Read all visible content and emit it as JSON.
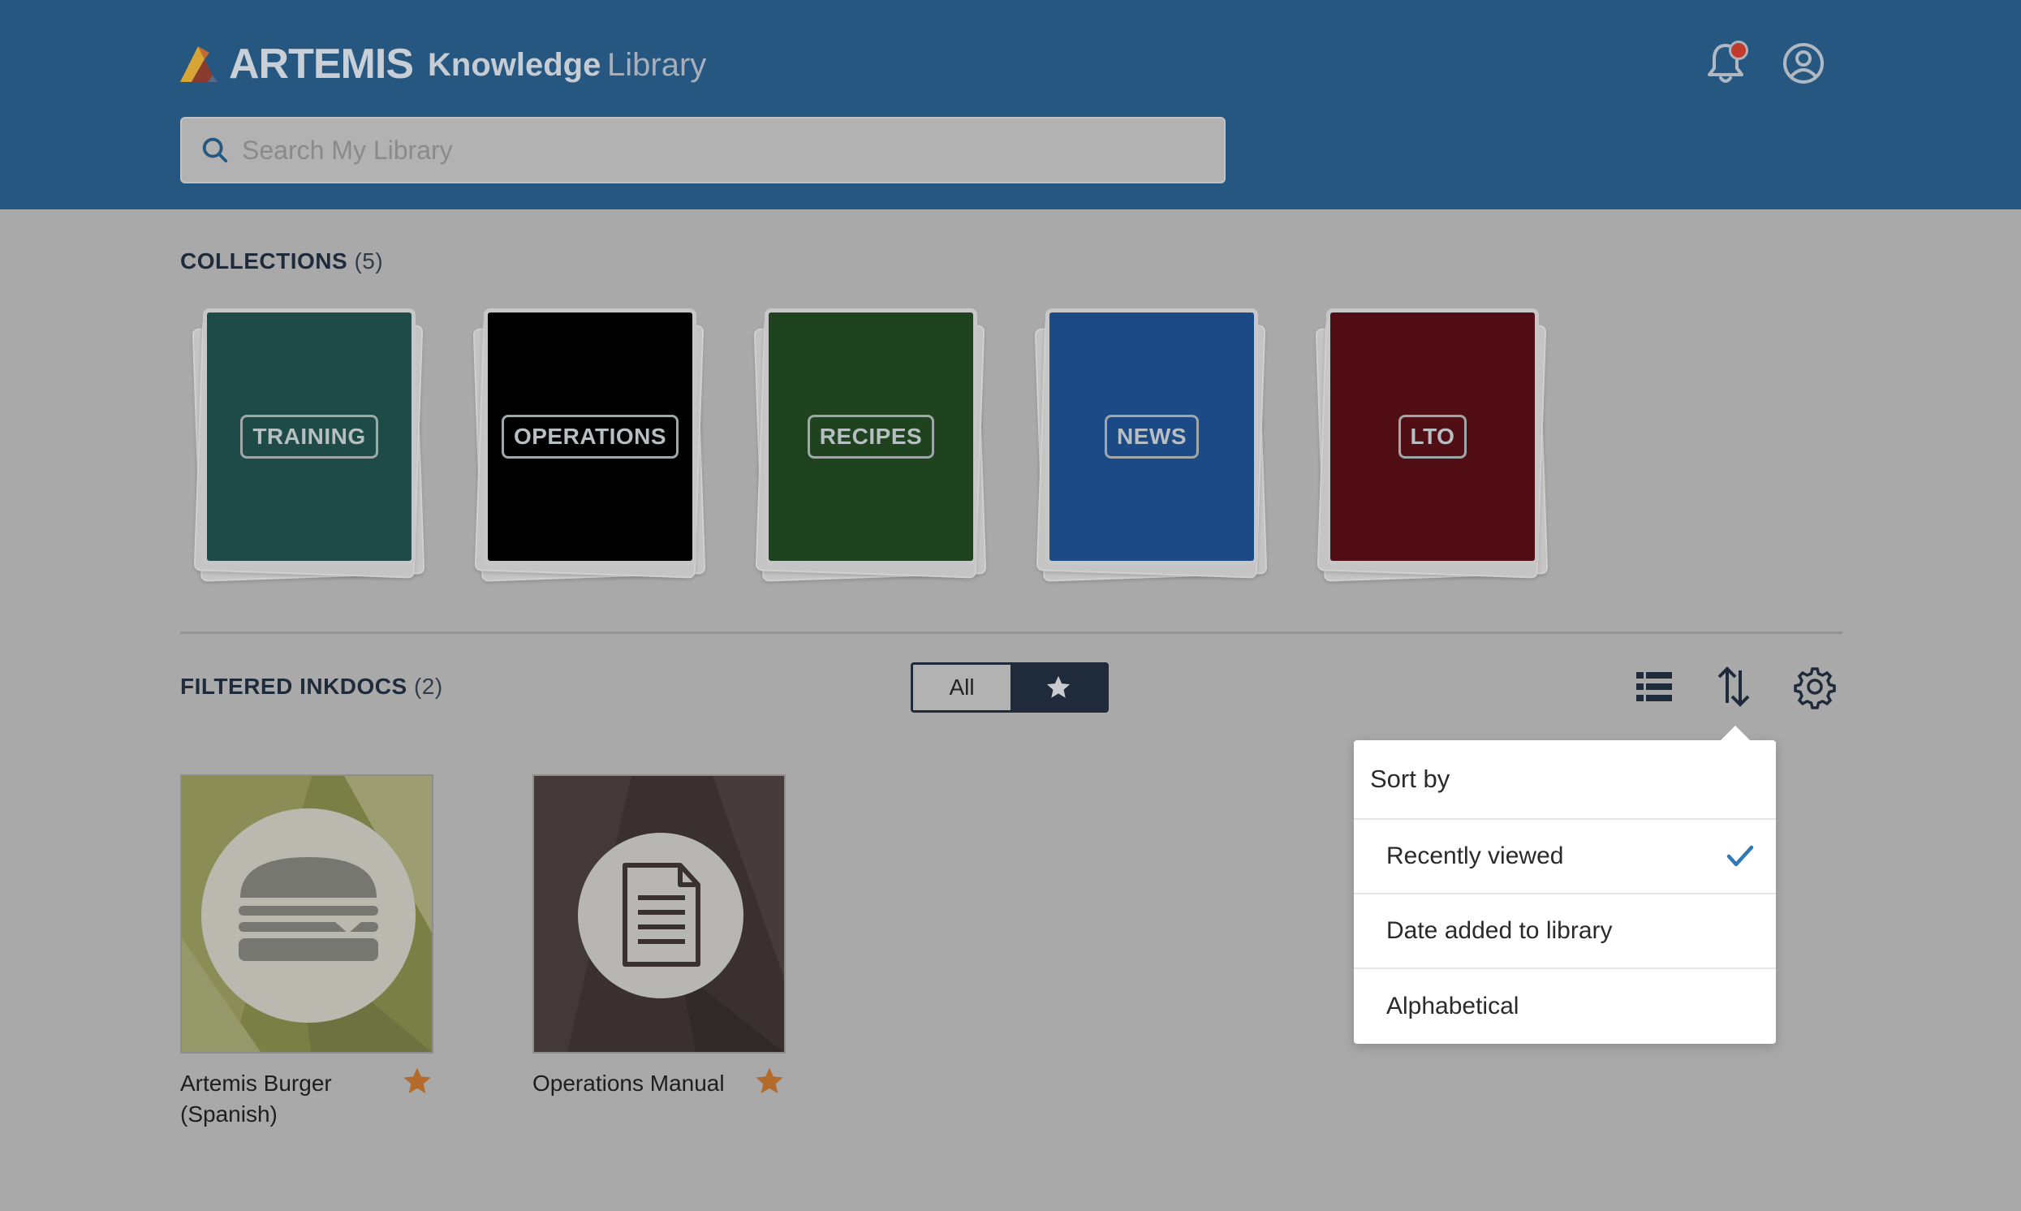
{
  "header": {
    "brand": "ARTEMIS",
    "product_main": "Knowledge",
    "product_sub": "Library",
    "search_placeholder": "Search My Library",
    "icons": [
      "bell-icon",
      "user-icon",
      "search-icon"
    ]
  },
  "collections": {
    "title": "COLLECTIONS",
    "count": "(5)",
    "items": [
      {
        "label": "TRAINING",
        "color": "#1e4a47"
      },
      {
        "label": "OPERATIONS",
        "color": "#000000"
      },
      {
        "label": "RECIPES",
        "color": "#1f431f"
      },
      {
        "label": "NEWS",
        "color": "#1b4a86"
      },
      {
        "label": "LTO",
        "color": "#510f15"
      }
    ]
  },
  "inkdocs": {
    "title": "FILTERED INKDOCS",
    "count": "(2)",
    "filter_all": "All",
    "items": [
      {
        "title": "Artemis Burger (Spanish)",
        "starred": true,
        "icon": "burger-icon"
      },
      {
        "title": "Operations Manual",
        "starred": true,
        "icon": "document-icon"
      }
    ]
  },
  "toolbar": {
    "icons": [
      "list-view-icon",
      "sort-icon",
      "settings-icon"
    ]
  },
  "sort_menu": {
    "heading": "Sort by",
    "options": [
      {
        "label": "Recently viewed",
        "selected": true
      },
      {
        "label": "Date added to library",
        "selected": false
      },
      {
        "label": "Alphabetical",
        "selected": false
      }
    ]
  },
  "colors": {
    "header_bg": "#265780",
    "overlay_bg": "#a9a9aa",
    "star": "#b36a2a",
    "check": "#2f78b4"
  }
}
